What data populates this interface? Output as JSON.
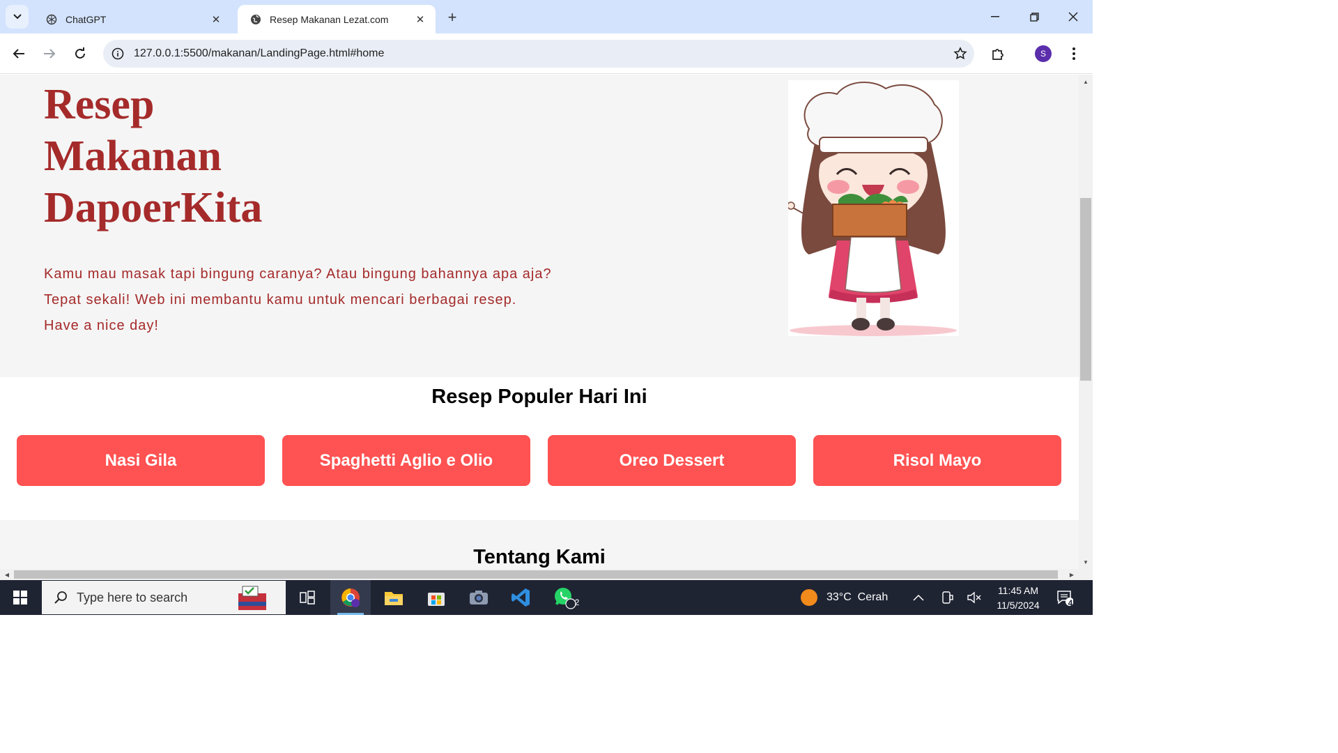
{
  "browser": {
    "tabs": [
      {
        "title": "ChatGPT",
        "active": false
      },
      {
        "title": "Resep Makanan Lezat.com",
        "active": true
      }
    ],
    "url": "127.0.0.1:5500/makanan/LandingPage.html#home",
    "profile_initial": "S"
  },
  "hero": {
    "title_lines": [
      "Resep",
      "Makanan",
      "DapoerKita"
    ],
    "intro_lines": [
      "Kamu mau masak tapi bingung caranya? Atau bingung bahannya apa aja?",
      "Tepat sekali! Web ini membantu kamu untuk mencari berbagai resep.",
      "Have a nice day!"
    ]
  },
  "popular": {
    "heading": "Resep Populer Hari Ini",
    "recipes": [
      "Nasi Gila",
      "Spaghetti Aglio e Olio",
      "Oreo Dessert",
      "Risol Mayo"
    ]
  },
  "about": {
    "heading": "Tentang Kami"
  },
  "taskbar": {
    "search_placeholder": "Type here to search",
    "weather": "33°C  Cerah",
    "time": "11:45 AM",
    "date": "11/5/2024",
    "whatsapp_badge": "2",
    "notification_count": "4"
  },
  "colors": {
    "brand": "#a52a2a",
    "card": "#ff5252",
    "tabbar": "#d3e3fd"
  }
}
